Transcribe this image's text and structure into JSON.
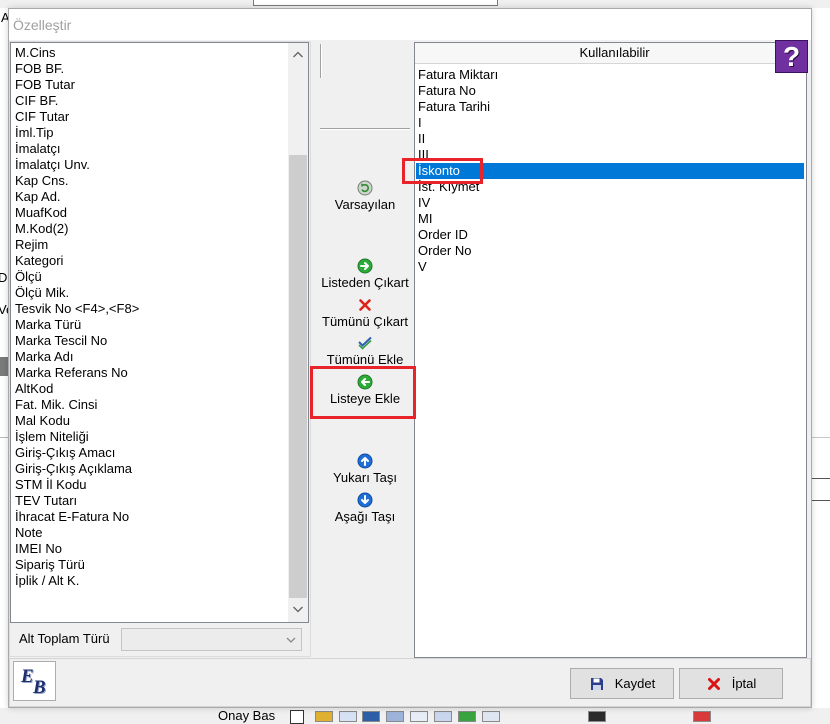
{
  "window": {
    "title": "Özelleştir"
  },
  "parent": {
    "left_fragments": [
      "A",
      "Di",
      "Ve"
    ],
    "status_bar": {
      "approve_label": "Onay Bas"
    }
  },
  "left_list": {
    "items": [
      "M.Cins",
      "FOB BF.",
      "FOB Tutar",
      "CIF BF.",
      "CIF Tutar",
      "İml.Tip",
      "İmalatçı",
      "İmalatçı Unv.",
      "Kap Cns.",
      "Kap Ad.",
      "MuafKod",
      "M.Kod(2)",
      "Rejim",
      "Kategori",
      "Ölçü",
      "Ölçü Mik.",
      "Tesvik No <F4>,<F8>",
      "Marka Türü",
      "Marka Tescil No",
      "Marka Adı",
      "Marka Referans No",
      "AltKod",
      "Fat. Mik. Cinsi",
      "Mal Kodu",
      "İşlem Niteliği",
      "Giriş-Çıkış Amacı",
      "Giriş-Çıkış Açıklama",
      "STM İl Kodu",
      "TEV Tutarı",
      "İhracat E-Fatura No",
      "Note",
      "IMEI No",
      "Sipariş Türü",
      "İplik / Alt K."
    ],
    "scroll": {
      "visible_fraction": 0.825,
      "position": 0.97
    }
  },
  "subtotal": {
    "label": "Alt Toplam Türü"
  },
  "actions": {
    "defaults": {
      "label": "Varsayılan",
      "icon": "reset-icon"
    },
    "remove": {
      "label": "Listeden Çıkart",
      "icon": "arrow-right-circle-icon"
    },
    "remove_all": {
      "label": "Tümünü Çıkart",
      "icon": "red-x-icon"
    },
    "add_all": {
      "label": "Tümünü Ekle",
      "icon": "double-check-icon"
    },
    "add": {
      "label": "Listeye Ekle",
      "icon": "arrow-left-circle-icon"
    },
    "move_up": {
      "label": "Yukarı Taşı",
      "icon": "arrow-up-circle-icon"
    },
    "move_down": {
      "label": "Aşağı Taşı",
      "icon": "arrow-down-circle-icon"
    }
  },
  "right_list": {
    "header": "Kullanılabilir",
    "items": [
      "Fatura Miktarı",
      "Fatura No",
      "Fatura Tarihi",
      "I",
      "II",
      "III",
      "İskonto",
      "İst. Kıymet",
      "IV",
      "MI",
      "Order ID",
      "Order No",
      "V"
    ],
    "selected_index": 6
  },
  "help": {
    "icon": "help-icon",
    "glyph": "?"
  },
  "logo": {
    "icon": "eb-logo-icon",
    "letters": [
      "E",
      "B"
    ]
  },
  "buttons": {
    "save": {
      "label": "Kaydet",
      "icon": "floppy-disk-icon"
    },
    "cancel": {
      "label": "İptal",
      "icon": "red-x-icon"
    }
  },
  "colors": {
    "selection": "#0078d7",
    "highlight": "#e8232a",
    "help_background": "#7030a0"
  }
}
